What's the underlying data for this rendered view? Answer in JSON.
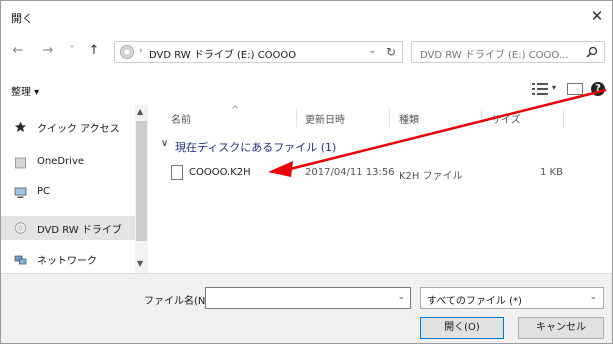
{
  "window": {
    "title": "開く",
    "close_glyph": "✕"
  },
  "address": {
    "back": "←",
    "forward": "→",
    "recent": "˅",
    "up": "↑",
    "separator": "›",
    "path": "DVD RW ドライブ (E:) COOOO",
    "dropdown": "⌄",
    "refresh": "↻",
    "search_placeholder": "DVD RW ドライブ (E:) COOO..."
  },
  "toolbar": {
    "organize": "整理 ▾",
    "view_dropdown": "▾",
    "help": "?"
  },
  "nav": {
    "items": [
      {
        "label": "クイック アクセス",
        "icon": "star-icon",
        "selected": false
      },
      {
        "label": "OneDrive",
        "icon": "cloud-icon",
        "selected": false
      },
      {
        "label": "PC",
        "icon": "pc-icon",
        "selected": false
      },
      {
        "label": "DVD RW ドライブ",
        "icon": "dvd-icon",
        "selected": true
      },
      {
        "label": "ネットワーク",
        "icon": "network-icon",
        "selected": false
      }
    ],
    "scroll_up": "▲",
    "scroll_down": "▼"
  },
  "files": {
    "columns": [
      "名前",
      "更新日時",
      "種類",
      "サイズ"
    ],
    "sort_indicator": "^",
    "group_chevron": "∨",
    "group_header": "現在ディスクにあるファイル (1)",
    "rows": [
      {
        "name": "COOOO.K2H",
        "modified": "2017/04/11 13:56",
        "type": "K2H ファイル",
        "size": "1 KB"
      }
    ]
  },
  "bottom": {
    "filename_label": "ファイル名(N):",
    "filename_value": "",
    "filename_dropdown": "⌄",
    "filetype_value": "すべてのファイル (*)",
    "filetype_dropdown": "⌄",
    "open_button": "開く(O)",
    "cancel_button": "キャンセル"
  },
  "annotation": {
    "arrow_color": "#e8000b"
  }
}
